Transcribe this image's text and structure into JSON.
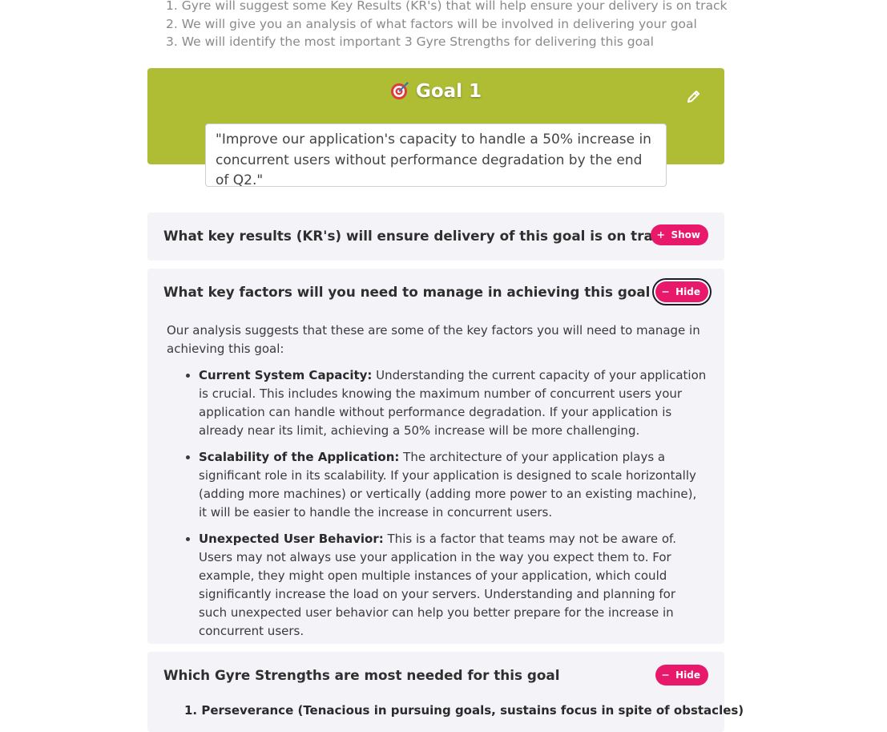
{
  "intro_steps": [
    "1. Gyre will suggest some Key Results (KR's) that will help ensure your delivery is on track",
    "2. We will give you an analysis of what factors will be involved in delivering your goal",
    "3. We will identify the most important 3 Gyre Strengths for delivering this goal"
  ],
  "goal": {
    "title": "Goal 1",
    "statement": "\"Improve our application's capacity to handle a 50% increase in concurrent users without performance degradation by the end of Q2.\""
  },
  "sections": {
    "key_results": {
      "title": "What key results (KR's) will ensure delivery of this goal is on track",
      "button_label": "Show"
    },
    "key_factors": {
      "title": "What key factors will you need to manage in achieving this goal",
      "button_label": "Hide",
      "intro": "Our analysis suggests that these are some of the key factors you will need to manage in achieving this goal:",
      "factors": [
        {
          "name": "Current System Capacity:",
          "text": " Understanding the current capacity of your application is crucial. This includes knowing the maximum number of concurrent users your application can handle without performance degradation. If your application is already near its limit, achieving a 50% increase will be more challenging."
        },
        {
          "name": "Scalability of the Application:",
          "text": " The architecture of your application plays a significant role in its scalability. If your application is designed to scale horizontally (adding more machines) or vertically (adding more power to an existing machine), it will be easier to handle the increase in concurrent users."
        },
        {
          "name": "Unexpected User Behavior:",
          "text": " This is a factor that teams may not be aware of. Users may not always use your application in the way you expect them to. For example, they might open multiple instances of your application, which could significantly increase the load on your servers. Understanding and planning for such unexpected user behavior can help you better prepare for the increase in concurrent users."
        }
      ]
    },
    "strengths": {
      "title": "Which Gyre Strengths are most needed for this goal",
      "button_label": "Hide",
      "first_item_partial": "1.  Perseverance (Tenacious in pursuing goals, sustains focus in spite of obstacles)"
    }
  },
  "icons": {
    "goal": "target-icon",
    "edit": "pencil-icon",
    "show": "plus-icon",
    "hide": "minus-icon"
  },
  "colors": {
    "goal_banner": "#afbd34",
    "pill_button": "#e8196a",
    "section_bg": "#f4f4f8"
  }
}
